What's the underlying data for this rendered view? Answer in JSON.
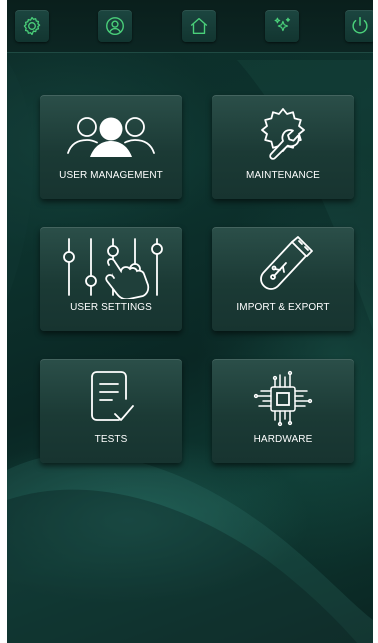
{
  "topbar": {
    "buttons": [
      {
        "name": "settings",
        "icon": "gear-icon"
      },
      {
        "name": "profile",
        "icon": "user-circle-icon"
      },
      {
        "name": "home",
        "icon": "home-icon"
      },
      {
        "name": "effects",
        "icon": "sparkle-icon"
      },
      {
        "name": "power",
        "icon": "power-icon"
      }
    ],
    "icon_color": "#4ad07a"
  },
  "menu": {
    "tiles": [
      {
        "label": "USER MANAGEMENT",
        "icon": "users-group-icon"
      },
      {
        "label": "MAINTENANCE",
        "icon": "wrench-gear-icon"
      },
      {
        "label": "USER SETTINGS",
        "icon": "sliders-hand-icon"
      },
      {
        "label": "IMPORT & EXPORT",
        "icon": "usb-drive-icon"
      },
      {
        "label": "TESTS",
        "icon": "checklist-icon"
      },
      {
        "label": "HARDWARE",
        "icon": "chip-icon"
      }
    ]
  }
}
